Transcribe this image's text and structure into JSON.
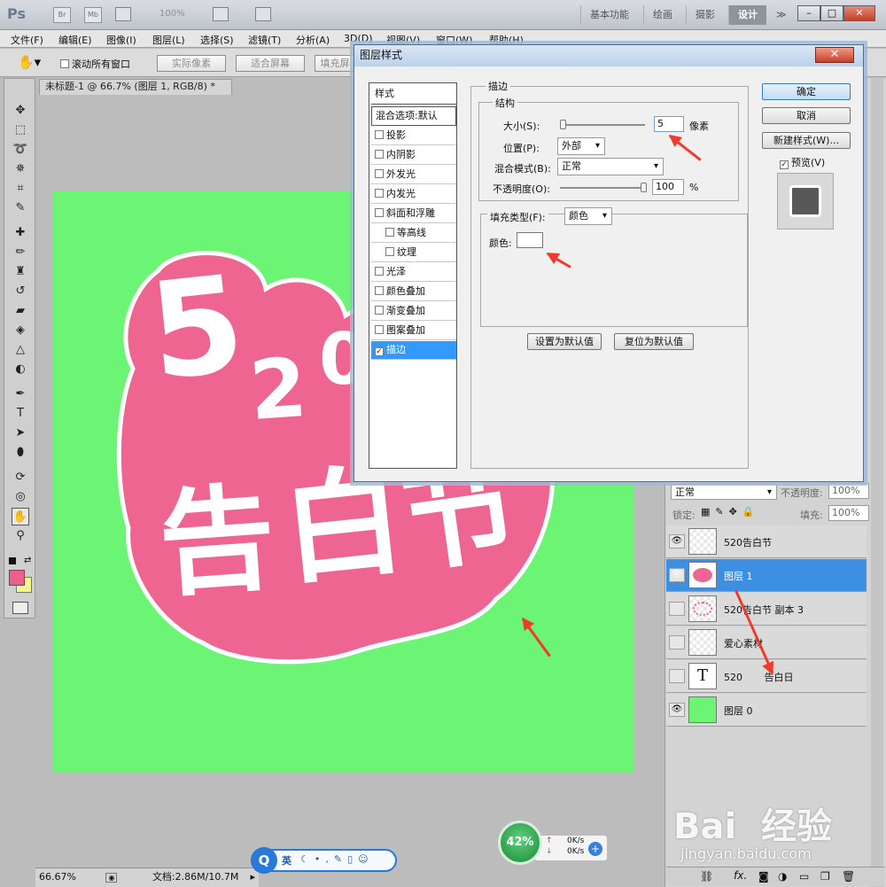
{
  "app": {
    "logo": "Ps",
    "badges": [
      "Br",
      "Mb"
    ],
    "zoom_display": "100%",
    "workspaces": [
      "基本功能",
      "绘画",
      "摄影",
      "设计"
    ],
    "workspace_more": "≫",
    "window_controls": [
      "–",
      "□",
      "✕"
    ]
  },
  "menu": [
    "文件(F)",
    "编辑(E)",
    "图像(I)",
    "图层(L)",
    "选择(S)",
    "滤镜(T)",
    "分析(A)",
    "3D(D)",
    "视图(V)",
    "窗口(W)",
    "帮助(H)"
  ],
  "options": {
    "scroll_all_label": "滚动所有窗口",
    "actual_pixels": "实际像素",
    "fit_screen": "适合屏幕",
    "fill_screen": "填充屏"
  },
  "document": {
    "tab_title": "未标题-1 @ 66.7% (图层 1, RGB/8) *",
    "tab_close": "✕",
    "artwork_text": [
      "5",
      "2",
      "0",
      "告",
      "白",
      "节"
    ],
    "status_zoom": "66.67%",
    "status_doc": "文档:2.86M/10.7M"
  },
  "dialog": {
    "title": "图层样式",
    "close": "✕",
    "styles_header": "样式",
    "blend_default": "混合选项:默认",
    "styles": [
      {
        "label": "投影",
        "checked": false
      },
      {
        "label": "内阴影",
        "checked": false
      },
      {
        "label": "外发光",
        "checked": false
      },
      {
        "label": "内发光",
        "checked": false
      },
      {
        "label": "斜面和浮雕",
        "checked": false
      },
      {
        "label": "等高线",
        "checked": false
      },
      {
        "label": "纹理",
        "checked": false
      },
      {
        "label": "光泽",
        "checked": false
      },
      {
        "label": "颜色叠加",
        "checked": false
      },
      {
        "label": "渐变叠加",
        "checked": false
      },
      {
        "label": "图案叠加",
        "checked": false
      },
      {
        "label": "描边",
        "checked": true
      }
    ],
    "checkmark": "✓",
    "stroke_title": "描边",
    "structure_title": "结构",
    "size_label": "大小(S):",
    "size_value": "5",
    "size_unit": "像素",
    "position_label": "位置(P):",
    "position_value": "外部",
    "blend_mode_label": "混合模式(B):",
    "blend_mode_value": "正常",
    "opacity_label": "不透明度(O):",
    "opacity_value": "100",
    "opacity_unit": "%",
    "fill_type_label": "填充类型(F):",
    "fill_type_value": "颜色",
    "color_label": "颜色:",
    "set_default": "设置为默认值",
    "reset_default": "复位为默认值",
    "ok": "确定",
    "cancel": "取消",
    "new_style": "新建样式(W)...",
    "preview_label": "预览(V)",
    "preview_checked": true
  },
  "layers_panel": {
    "blend_mode": "正常",
    "opacity_label": "不透明度:",
    "opacity_value": "100%",
    "lock_label": "锁定:",
    "fill_label": "填充:",
    "fill_value": "100%",
    "layers": [
      {
        "name": "520告白节",
        "visible": true,
        "selected": false,
        "type": "raster"
      },
      {
        "name": "图层 1",
        "visible": true,
        "selected": true,
        "type": "raster"
      },
      {
        "name": "520告白节 副本 3",
        "visible": false,
        "selected": false,
        "type": "raster"
      },
      {
        "name": "爱心素材",
        "visible": false,
        "selected": false,
        "type": "raster"
      },
      {
        "name": "520       告白日",
        "visible": false,
        "selected": false,
        "type": "text",
        "thumb": "T"
      },
      {
        "name": "图层 0",
        "visible": true,
        "selected": false,
        "type": "fill"
      }
    ],
    "footer_icons": [
      "link-icon",
      "fx-icon",
      "mask-icon",
      "adjustment-icon",
      "folder-icon",
      "new-layer-icon",
      "trash-icon"
    ],
    "fx_label": "fx."
  },
  "taskbar": {
    "ime_logo": "Q",
    "ime_label": "英",
    "net_percent": "42%",
    "net_up": "0K/s",
    "net_down": "0K/s"
  },
  "watermark": {
    "brand": "Bai  经验",
    "url": "jingyan.baidu.com"
  },
  "colors": {
    "canvas_green": "#6cf474",
    "shape_pink": "#ef6591",
    "foreground": "#ee5f8c",
    "background": "#f4f78b",
    "selection_blue": "#3d8fe2",
    "annotation_red": "#ee3b2e"
  },
  "icons": {
    "tools": [
      "move-icon",
      "marquee-icon",
      "lasso-icon",
      "quick-select-icon",
      "crop-icon",
      "eyedropper-icon",
      "healing-icon",
      "brush-icon",
      "stamp-icon",
      "history-brush-icon",
      "eraser-icon",
      "bucket-icon",
      "blur-icon",
      "dodge-icon",
      "pen-icon",
      "text-icon",
      "path-select-icon",
      "ellipse-icon",
      "3d-rotate-icon",
      "3d-orbit-icon",
      "hand-icon",
      "zoom-icon"
    ]
  }
}
